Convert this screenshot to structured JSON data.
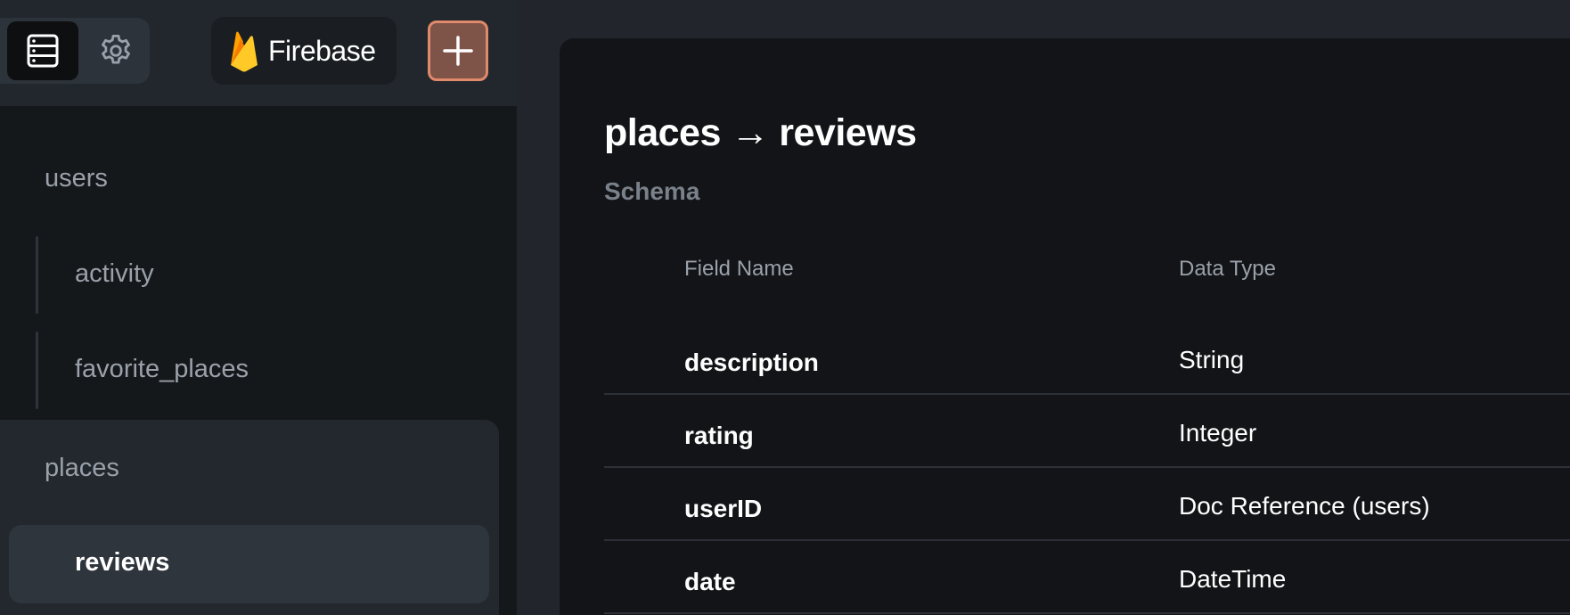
{
  "toolbar": {
    "brand_label": "Firebase"
  },
  "sidebar": {
    "tree": [
      {
        "label": "users",
        "children": [
          "activity",
          "favorite_places"
        ]
      },
      {
        "label": "places",
        "children": [
          "reviews"
        ]
      }
    ],
    "selected": "reviews"
  },
  "main": {
    "title": "places → reviews",
    "section": "Schema",
    "columns": [
      "Field Name",
      "Data Type"
    ],
    "rows": [
      {
        "field": "description",
        "type": "String"
      },
      {
        "field": "rating",
        "type": "Integer"
      },
      {
        "field": "userID",
        "type": "Doc Reference (users)"
      },
      {
        "field": "date",
        "type": "DateTime"
      }
    ]
  },
  "colors": {
    "accent": "#e0896b",
    "accent_fill": "#7f5448",
    "sidebar_bg": "#15181b",
    "main_bg": "#121417"
  },
  "icons": {
    "database": "database-icon",
    "settings": "gear-icon",
    "brand": "firebase-flame-icon",
    "add": "plus-icon"
  }
}
